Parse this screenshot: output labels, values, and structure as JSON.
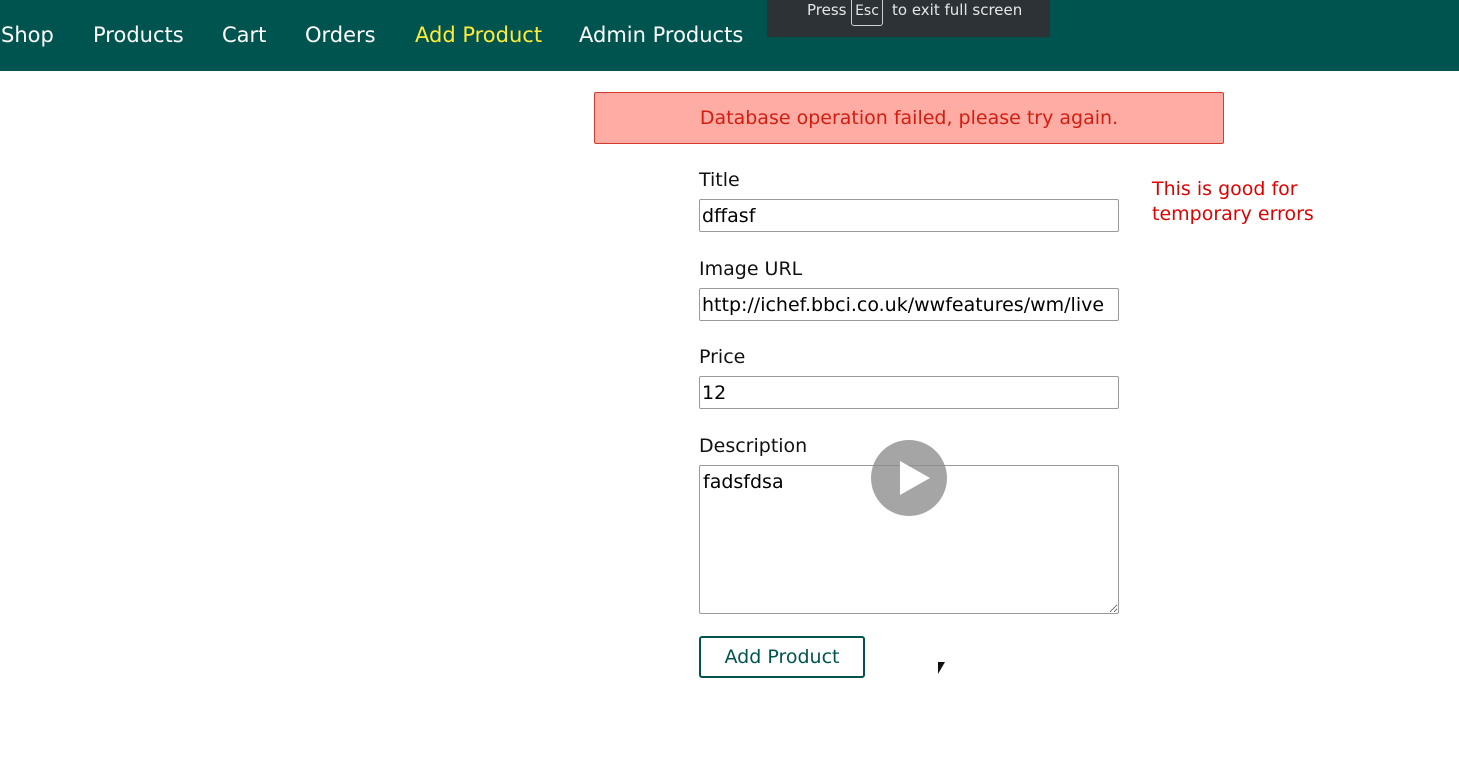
{
  "nav": {
    "items": [
      {
        "label": "Shop"
      },
      {
        "label": "Products"
      },
      {
        "label": "Cart"
      },
      {
        "label": "Orders"
      },
      {
        "label": "Add Product"
      },
      {
        "label": "Admin Products"
      }
    ],
    "active_item": "Add Product",
    "active_color": "#ffeb3b",
    "bar_color": "#00544f"
  },
  "fullscreen_banner": {
    "press": "Press",
    "key": "Esc",
    "suffix": "to exit full screen"
  },
  "alert": {
    "message": "Database operation failed, please try again."
  },
  "side_note": {
    "text": "This is good for temporary errors"
  },
  "form": {
    "title_label": "Title",
    "title_value": "dffasf",
    "image_url_label": "Image URL",
    "image_url_value": "http://ichef.bbci.co.uk/wwfeatures/wm/live",
    "price_label": "Price",
    "price_value": "12",
    "description_label": "Description",
    "description_value": "fadsfdsa",
    "submit_label": "Add Product"
  },
  "overlay": {
    "icon": "play-icon"
  }
}
